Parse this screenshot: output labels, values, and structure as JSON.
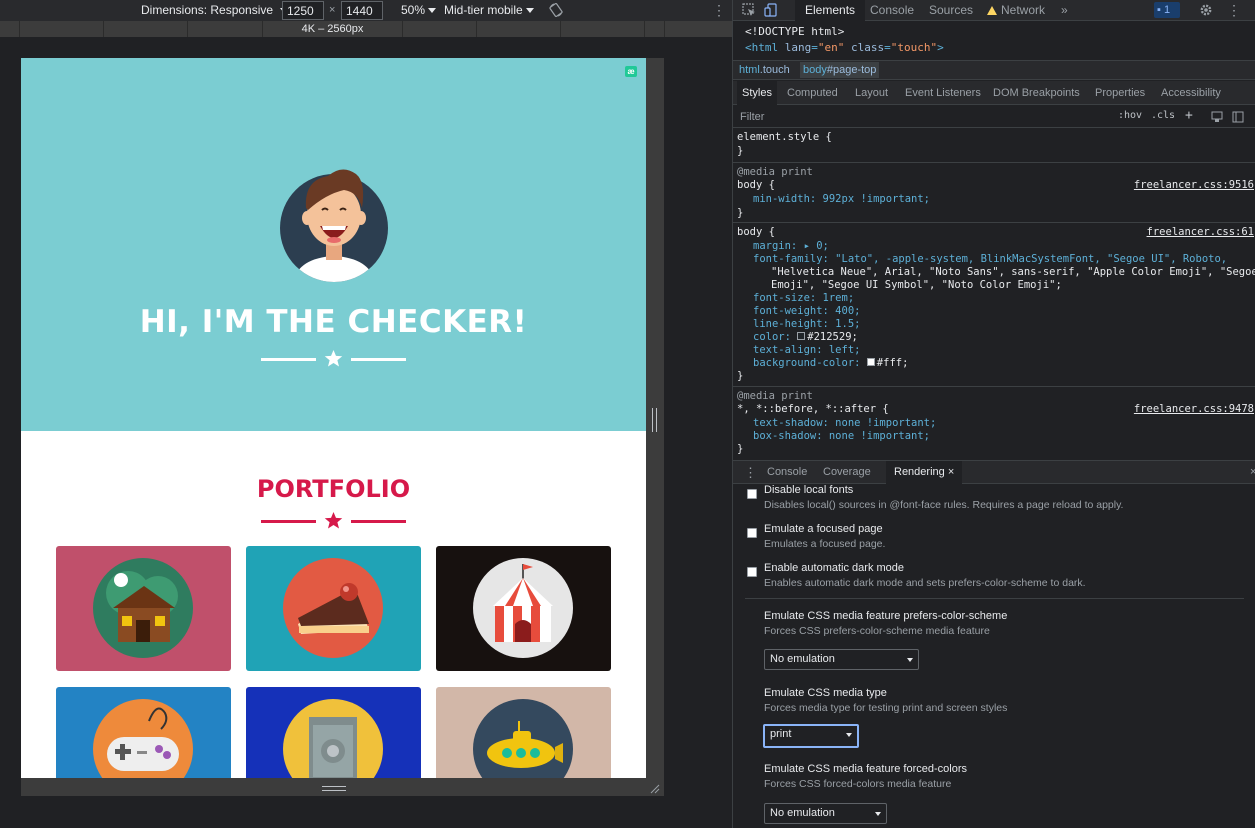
{
  "device_toolbar": {
    "dimensions_label": "Dimensions: Responsive",
    "width_value": "1250",
    "height_value": "1440",
    "times": "×",
    "zoom": "50%",
    "throttling": "Mid-tier mobile",
    "rotate_icon": "rotate-icon",
    "more_icon": "⋮"
  },
  "media_query_bar": {
    "label": "4K – 2560px"
  },
  "page": {
    "badge": "æ",
    "masthead_title": "HI, I'M THE CHECKER!",
    "portfolio_title": "PORTFOLIO",
    "colors": {
      "masthead_bg": "#7bcdd2",
      "accent": "#d6194a",
      "tiles": [
        "#c0506b",
        "#20a3b6",
        "#17110f",
        "#2383c4",
        "#1531b9",
        "#d2b7a8"
      ]
    },
    "tile_icons": [
      "cabin-icon",
      "cake-icon",
      "circus-tent-icon",
      "game-controller-icon",
      "safe-icon",
      "submarine-icon"
    ]
  },
  "devtools": {
    "tabs": [
      "Elements",
      "Console",
      "Sources",
      "Network"
    ],
    "active_tab": "Elements",
    "more_tabs": "»",
    "issues_count": "1",
    "dom": {
      "doctype": "<!DOCTYPE html>",
      "html_open": "<html",
      "attr1_name": " lang",
      "attr1_value": "\"en\"",
      "attr2_name": " class",
      "attr2_value": "\"touch\"",
      "close": ">"
    },
    "breadcrumbs": {
      "html": "html",
      "html_class": ".touch",
      "body": "body",
      "body_id": "#page-top"
    },
    "panel_tabs": [
      "Styles",
      "Computed",
      "Layout",
      "Event Listeners",
      "DOM Breakpoints",
      "Properties",
      "Accessibility"
    ],
    "filter_placeholder": "Filter",
    "hov": ":hov",
    "cls": ".cls",
    "rules": {
      "element_style": "element.style {",
      "close_brace": "}",
      "media_print": "@media print",
      "body_sel": "body {",
      "src1": "freelancer.css:9516",
      "min_width": "min-width: 992px !important;",
      "src2": "freelancer.css:61",
      "margin": "margin: ▸ 0;",
      "font_family_1": "font-family: \"Lato\", -apple-system, BlinkMacSystemFont, \"Segoe UI\", Roboto,",
      "font_family_2": "\"Helvetica Neue\", Arial, \"Noto Sans\", sans-serif, \"Apple Color Emoji\", \"Segoe UI",
      "font_family_3": "Emoji\", \"Segoe UI Symbol\", \"Noto Color Emoji\";",
      "font_size": "font-size: 1rem;",
      "font_weight": "font-weight: 400;",
      "line_height": "line-height: 1.5;",
      "color": "color: ",
      "color_value": "#212529;",
      "text_align": "text-align: left;",
      "bg_color": "background-color: ",
      "bg_value": "#fff;",
      "universal_sel": "*, *::before, *::after {",
      "src3": "freelancer.css:9478",
      "text_shadow": "text-shadow: none !important;",
      "box_shadow": "box-shadow: none !important;"
    },
    "drawer_tabs": [
      "Console",
      "Coverage",
      "Rendering"
    ],
    "drawer_close": "×",
    "rendering": {
      "items": [
        {
          "title": "Disable local fonts",
          "desc": "Disables local() sources in @font-face rules. Requires a page reload to apply."
        },
        {
          "title": "Emulate a focused page",
          "desc": "Emulates a focused page."
        },
        {
          "title": "Enable automatic dark mode",
          "desc": "Enables automatic dark mode and sets prefers-color-scheme to dark."
        }
      ],
      "color_scheme_title": "Emulate CSS media feature prefers-color-scheme",
      "color_scheme_desc": "Forces CSS prefers-color-scheme media feature",
      "color_scheme_value": "No emulation",
      "media_type_title": "Emulate CSS media type",
      "media_type_desc": "Forces media type for testing print and screen styles",
      "media_type_value": "print",
      "forced_colors_title": "Emulate CSS media feature forced-colors",
      "forced_colors_desc": "Forces CSS forced-colors media feature",
      "forced_colors_value": "No emulation"
    }
  }
}
